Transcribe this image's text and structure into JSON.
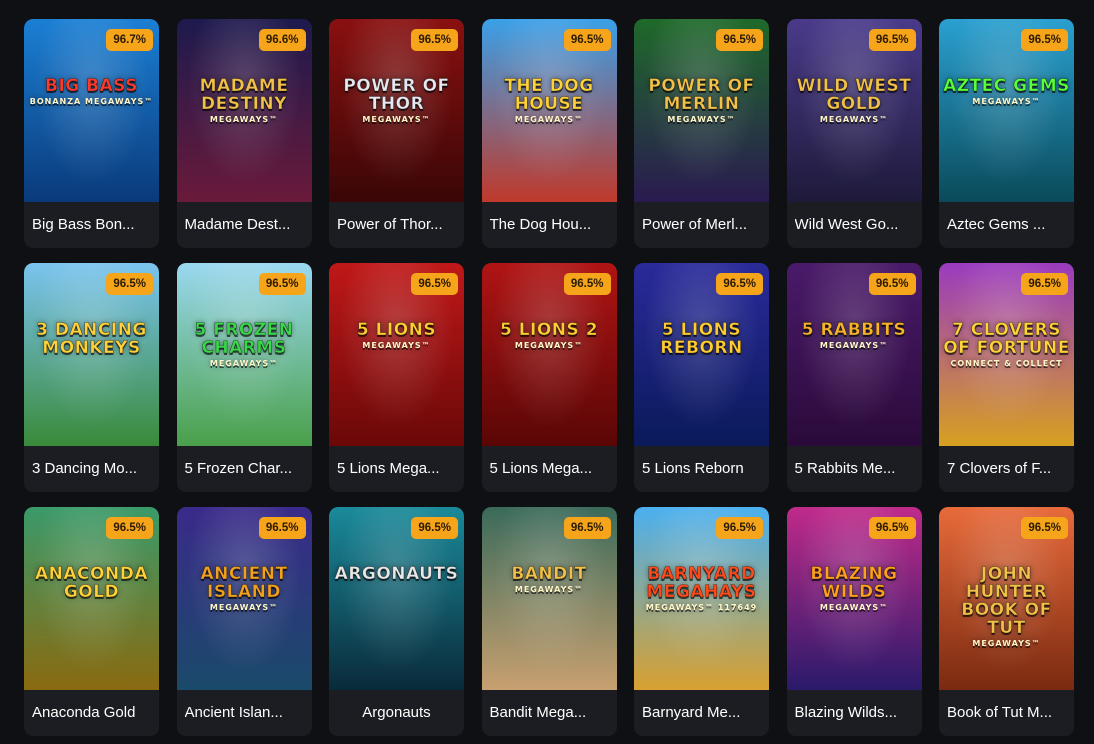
{
  "games": [
    {
      "title": "Big Bass Bon...",
      "rtp": "96.7%",
      "logo": "Big Bass",
      "logo_sub": "Bonanza Megaways™",
      "bg": [
        "#1b7fd4",
        "#0a3a7a"
      ],
      "logo_color": "#ff3a2a"
    },
    {
      "title": "Madame Dest...",
      "rtp": "96.6%",
      "logo": "Madame Destiny",
      "logo_sub": "Megaways™",
      "bg": [
        "#1d1a4e",
        "#6a1a3a"
      ],
      "logo_color": "#f2c14a"
    },
    {
      "title": "Power of Thor...",
      "rtp": "96.5%",
      "logo": "Power of Thor",
      "logo_sub": "Megaways™",
      "bg": [
        "#8a1010",
        "#3a0606"
      ],
      "logo_color": "#e8e8f0"
    },
    {
      "title": "The Dog Hou...",
      "rtp": "96.5%",
      "logo": "The Dog House",
      "logo_sub": "Megaways™",
      "bg": [
        "#3aa0e8",
        "#c0392b"
      ],
      "logo_color": "#ffd23a"
    },
    {
      "title": "Power of Merl...",
      "rtp": "96.5%",
      "logo": "Power of Merlin",
      "logo_sub": "Megaways™",
      "bg": [
        "#1f6a2a",
        "#2a1a50"
      ],
      "logo_color": "#f2c14a"
    },
    {
      "title": "Wild West Go...",
      "rtp": "96.5%",
      "logo": "Wild West Gold",
      "logo_sub": "Megaways™",
      "bg": [
        "#4a3a8a",
        "#1e1a3a"
      ],
      "logo_color": "#f2c14a"
    },
    {
      "title": "Aztec Gems ...",
      "rtp": "96.5%",
      "logo": "Aztec Gems",
      "logo_sub": "Megaways™",
      "bg": [
        "#2aa0d0",
        "#0a4a5a"
      ],
      "logo_color": "#5aff3a"
    },
    {
      "title": "3 Dancing Mo...",
      "rtp": "96.5%",
      "logo": "3 Dancing Monkeys",
      "logo_sub": "",
      "bg": [
        "#7ac4f0",
        "#3a8a3a"
      ],
      "logo_color": "#ffd23a"
    },
    {
      "title": "5 Frozen Char...",
      "rtp": "96.5%",
      "logo": "5 Frozen Charms",
      "logo_sub": "Megaways™",
      "bg": [
        "#9ad8f0",
        "#4aa04a"
      ],
      "logo_color": "#3ad84a"
    },
    {
      "title": "5 Lions Mega...",
      "rtp": "96.5%",
      "logo": "5 Lions",
      "logo_sub": "Megaways™",
      "bg": [
        "#c01818",
        "#6a0808"
      ],
      "logo_color": "#ffcc33"
    },
    {
      "title": "5 Lions Mega...",
      "rtp": "96.5%",
      "logo": "5 Lions 2",
      "logo_sub": "Megaways™",
      "bg": [
        "#b01414",
        "#5a0606"
      ],
      "logo_color": "#ffcc33"
    },
    {
      "title": "5 Lions Reborn",
      "rtp": "96.5%",
      "logo": "5 Lions Reborn",
      "logo_sub": "",
      "bg": [
        "#2a2a9a",
        "#0a1a5a"
      ],
      "logo_color": "#ffcc33"
    },
    {
      "title": "5 Rabbits Me...",
      "rtp": "96.5%",
      "logo": "5 Rabbits",
      "logo_sub": "Megaways™",
      "bg": [
        "#4a1a6a",
        "#2a0a3a"
      ],
      "logo_color": "#f7b32a"
    },
    {
      "title": "7 Clovers of F...",
      "rtp": "96.5%",
      "logo": "7 Clovers of Fortune",
      "logo_sub": "Connect & Collect",
      "bg": [
        "#9a3ac0",
        "#d8a020"
      ],
      "logo_color": "#ffd23a"
    },
    {
      "title": "Anaconda Gold",
      "rtp": "96.5%",
      "logo": "Anaconda Gold",
      "logo_sub": "",
      "bg": [
        "#3a9a6a",
        "#8a6a10"
      ],
      "logo_color": "#ffd23a"
    },
    {
      "title": "Ancient Islan...",
      "rtp": "96.5%",
      "logo": "Ancient Island",
      "logo_sub": "Megaways™",
      "bg": [
        "#3a2a8a",
        "#1a4a6a"
      ],
      "logo_color": "#f2a020"
    },
    {
      "title": "Argonauts",
      "rtp": "96.5%",
      "logo": "Argonauts",
      "logo_sub": "",
      "bg": [
        "#1a8a9a",
        "#0a2a3a"
      ],
      "logo_color": "#e8e8e8"
    },
    {
      "title": "Bandit Mega...",
      "rtp": "96.5%",
      "logo": "Bandit",
      "logo_sub": "Megaways™",
      "bg": [
        "#3a6a5a",
        "#c8a070"
      ],
      "logo_color": "#f2c14a"
    },
    {
      "title": "Barnyard Me...",
      "rtp": "96.5%",
      "logo": "Barnyard Megahays",
      "logo_sub": "Megaways™ 117649",
      "bg": [
        "#4ab0f0",
        "#d8a030"
      ],
      "logo_color": "#ff4a1a"
    },
    {
      "title": "Blazing Wilds...",
      "rtp": "96.5%",
      "logo": "Blazing Wilds",
      "logo_sub": "Megaways™",
      "bg": [
        "#c02a8a",
        "#2a1a6a"
      ],
      "logo_color": "#ffa020"
    },
    {
      "title": "Book of Tut M...",
      "rtp": "96.5%",
      "logo": "John Hunter Book of Tut",
      "logo_sub": "Megaways™",
      "bg": [
        "#e86a3a",
        "#7a2a10"
      ],
      "logo_color": "#f2c14a"
    }
  ]
}
